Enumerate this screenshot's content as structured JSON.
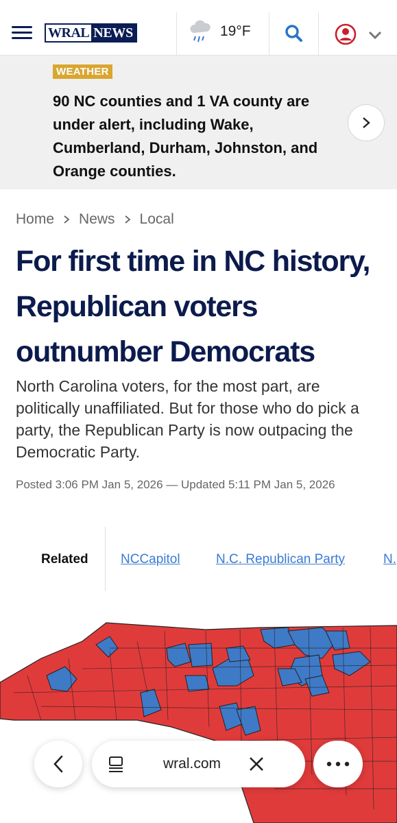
{
  "header": {
    "logo_left": "WRAL",
    "logo_right": "NEWS",
    "temperature": "19°F",
    "icons": {
      "menu": "hamburger-menu-icon",
      "weather": "rain-cloud-icon",
      "search": "search-icon",
      "account": "user-account-icon",
      "dropdown": "chevron-down-icon"
    }
  },
  "alert": {
    "badge": "WEATHER",
    "text": "90 NC counties and 1 VA county are under alert, including Wake, Cumberland, Durham, Johnston, and Orange counties.",
    "next_icon": "chevron-right-icon"
  },
  "breadcrumb": [
    "Home",
    "News",
    "Local"
  ],
  "article": {
    "headline": "For first time in NC history, Republican voters outnumber Democrats",
    "dek": "North Carolina voters, for the most part, are politically unaffiliated. But for those who do pick a party, the Republican Party is now outpacing the Democratic Party.",
    "dateline": "Posted 3:06 PM Jan 5, 2026 — Updated 5:11 PM Jan 5, 2026"
  },
  "related": {
    "label": "Related",
    "links": [
      "NCCapitol",
      "N.C. Republican Party",
      "N."
    ]
  },
  "map": {
    "colors": {
      "republican": "#e03b3b",
      "democrat": "#3f7ac7",
      "border": "#222222"
    }
  },
  "browser": {
    "url": "wral.com",
    "icons": [
      "back-icon",
      "tabs-icon",
      "close-icon",
      "more-icon"
    ]
  }
}
